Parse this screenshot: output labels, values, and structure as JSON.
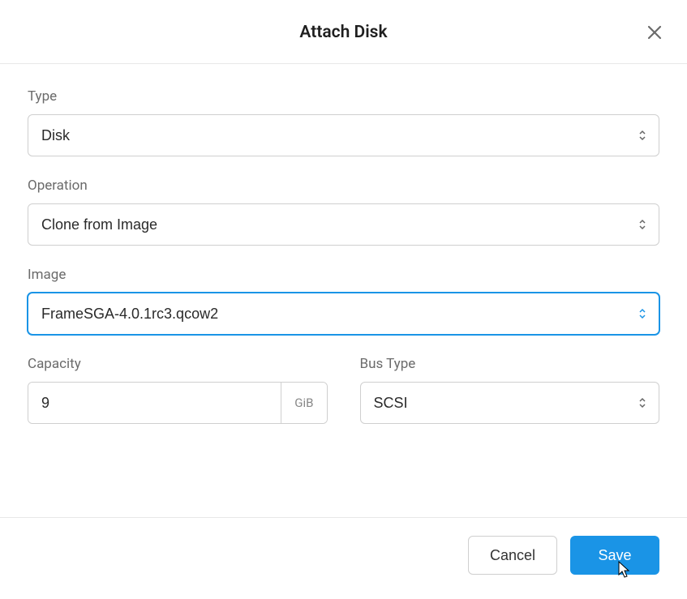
{
  "modal": {
    "title": "Attach Disk"
  },
  "form": {
    "type": {
      "label": "Type",
      "value": "Disk"
    },
    "operation": {
      "label": "Operation",
      "value": "Clone from Image"
    },
    "image": {
      "label": "Image",
      "value": "FrameSGA-4.0.1rc3.qcow2"
    },
    "capacity": {
      "label": "Capacity",
      "value": "9",
      "unit": "GiB"
    },
    "busType": {
      "label": "Bus Type",
      "value": "SCSI"
    }
  },
  "actions": {
    "cancel": "Cancel",
    "save": "Save"
  }
}
